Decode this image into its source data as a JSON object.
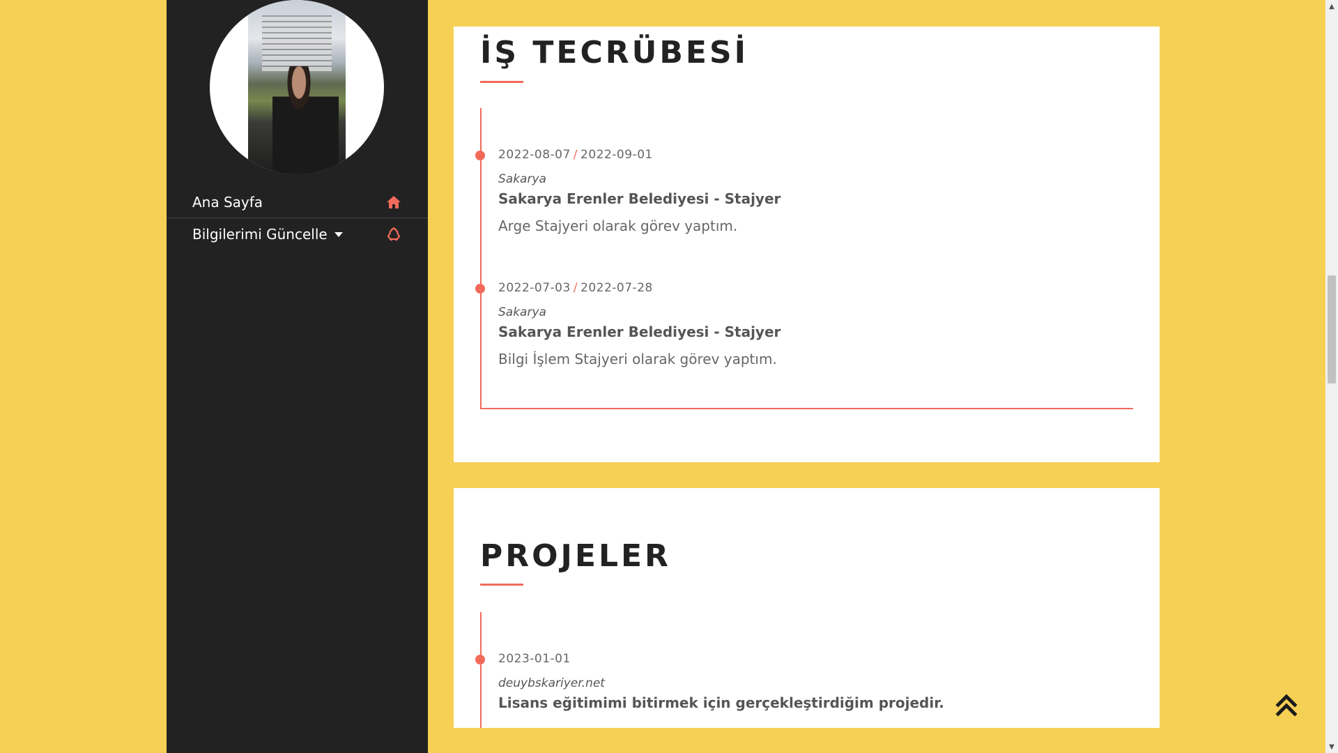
{
  "sidebar": {
    "nav": [
      {
        "label": "Ana Sayfa",
        "icon": "home-icon"
      },
      {
        "label": "Bilgilerimi Güncelle",
        "icon": "recycle-icon",
        "has_dropdown": true
      }
    ]
  },
  "experience": {
    "title": "İŞ TECRÜBESİ",
    "items": [
      {
        "start": "2022-08-07",
        "separator": "/",
        "end": "2022-09-01",
        "location": "Sakarya",
        "role": "Sakarya Erenler Belediyesi - Stajyer",
        "description": "Arge Stajyeri olarak görev yaptım."
      },
      {
        "start": "2022-07-03",
        "separator": "/",
        "end": "2022-07-28",
        "location": "Sakarya",
        "role": "Sakarya Erenler Belediyesi - Stajyer",
        "description": "Bilgi İşlem Stajyeri olarak görev yaptım."
      }
    ]
  },
  "projects": {
    "title": "PROJELER",
    "items": [
      {
        "date": "2023-01-01",
        "site": "deuybskariyer.net",
        "description": "Lisans eğitimimi bitirmek için gerçekleştirdiğim projedir."
      }
    ]
  },
  "colors": {
    "background": "#f6cf55",
    "sidebar": "#222222",
    "accent": "#f16a5a"
  }
}
